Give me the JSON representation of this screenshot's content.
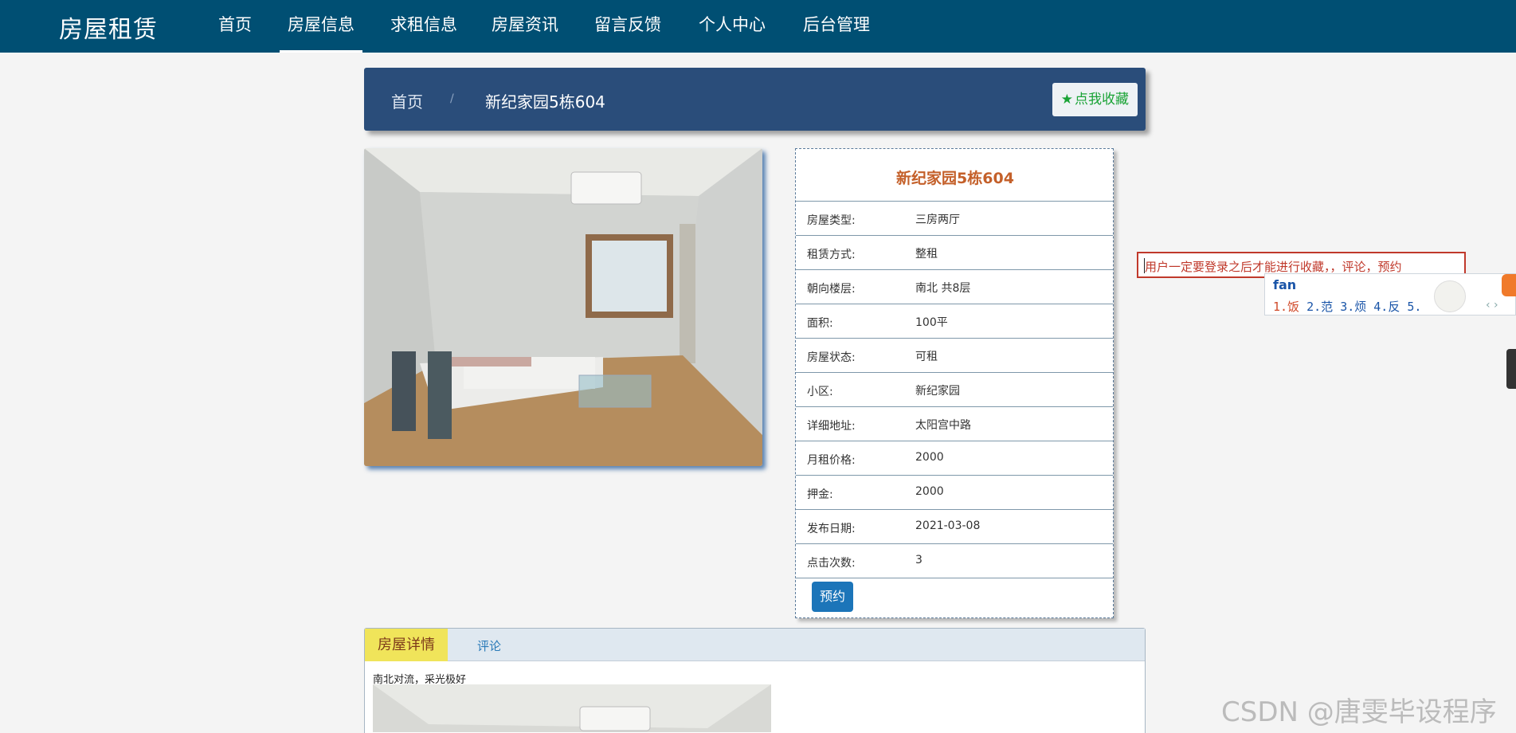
{
  "brand": "房屋租赁",
  "nav": {
    "items": [
      "首页",
      "房屋信息",
      "求租信息",
      "房屋资讯",
      "留言反馈",
      "个人中心",
      "后台管理"
    ]
  },
  "breadcrumb": {
    "home": "首页",
    "separator": "/",
    "current": "新纪家园5栋604"
  },
  "favorite_button": "点我收藏",
  "house": {
    "title": "新纪家园5栋604",
    "fields": [
      {
        "label": "房屋类型:",
        "value": "三房两厅"
      },
      {
        "label": "租赁方式:",
        "value": "整租"
      },
      {
        "label": "朝向楼层:",
        "value": "南北 共8层"
      },
      {
        "label": "面积:",
        "value": "100平"
      },
      {
        "label": "房屋状态:",
        "value": "可租"
      },
      {
        "label": "小区:",
        "value": "新纪家园"
      },
      {
        "label": "详细地址:",
        "value": "太阳宫中路"
      },
      {
        "label": "月租价格:",
        "value": "2000"
      },
      {
        "label": "押金:",
        "value": "2000"
      },
      {
        "label": "发布日期:",
        "value": "2021-03-08"
      },
      {
        "label": "点击次数:",
        "value": "3"
      }
    ],
    "book_button": "预约"
  },
  "notice": "用户一定要登录之后才能进行收藏，，评论，预约",
  "ime": {
    "pinyin": "fan",
    "candidates": [
      "1.饭",
      "2.范",
      "3.烦",
      "4.反",
      "5."
    ]
  },
  "tabs": {
    "detail": "房屋详情",
    "comment": "评论"
  },
  "description": "南北对流，采光极好",
  "watermark": "CSDN @唐雯毕设程序",
  "colors": {
    "nav_bg": "#004f73",
    "breadcrumb_bg": "#2a4d7a",
    "title_accent": "#c4602a",
    "favorite_green": "#1aa336",
    "book_button_bg": "#1c75b9",
    "notice_red": "#c0392b",
    "detail_tab_bg": "#f0e45a"
  }
}
